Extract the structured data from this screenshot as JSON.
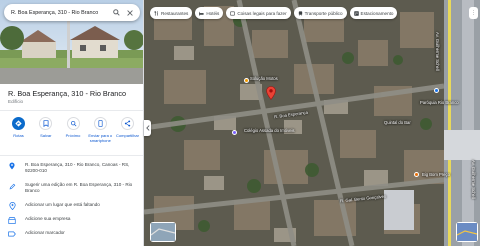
{
  "search": {
    "query": "R. Boa Esperança, 310 - Rio Branco"
  },
  "place": {
    "title": "R. Boa Esperança, 310 - Rio Branco",
    "category": "Edifício"
  },
  "actions": [
    {
      "label": "Rotas",
      "icon": "directions-icon"
    },
    {
      "label": "Salvar",
      "icon": "bookmark-icon"
    },
    {
      "label": "Próximo",
      "icon": "nearby-icon"
    },
    {
      "label": "Enviar para o smartphone",
      "icon": "send-phone-icon"
    },
    {
      "label": "Compartilhar",
      "icon": "share-icon"
    }
  ],
  "info": [
    {
      "text": "R. Boa Esperança, 310 - Rio Branco, Canoas - RS, 92200-010",
      "icon": "location-pin-icon"
    },
    {
      "text": "Sugerir uma edição em R. Boa Esperança, 310 - Rio Branco",
      "icon": "edit-icon"
    },
    {
      "text": "Adicionar um lugar que está faltando",
      "icon": "add-place-icon"
    },
    {
      "text": "Adicione sua empresa",
      "icon": "business-icon"
    },
    {
      "text": "Adicionar marcador",
      "icon": "label-icon"
    }
  ],
  "chips": [
    {
      "label": "Restaurantes",
      "icon": "restaurant-icon"
    },
    {
      "label": "Hotéis",
      "icon": "hotel-icon"
    },
    {
      "label": "Coisas legais para fazer",
      "icon": "attractions-icon"
    },
    {
      "label": "Transporte público",
      "icon": "transit-icon"
    },
    {
      "label": "Estacionamento",
      "icon": "parking-icon"
    }
  ],
  "map_labels": {
    "street_1": "R. Boa Esperança",
    "street_2": "R. Gal. Bento Gonçalves",
    "street_3": "Av. Guilherme Schell",
    "street_4": "Av. Guilherme Schell",
    "poi_1": "Solução Motos",
    "poi_2": "Colégio Assada do Imóveis",
    "poi_3": "Quintal do Bar",
    "poi_4": "Paróquia Rio Branco",
    "poi_5": "Big Bom Preço"
  },
  "colors": {
    "accent": "#0b57d0",
    "pin": "#ea4335"
  }
}
